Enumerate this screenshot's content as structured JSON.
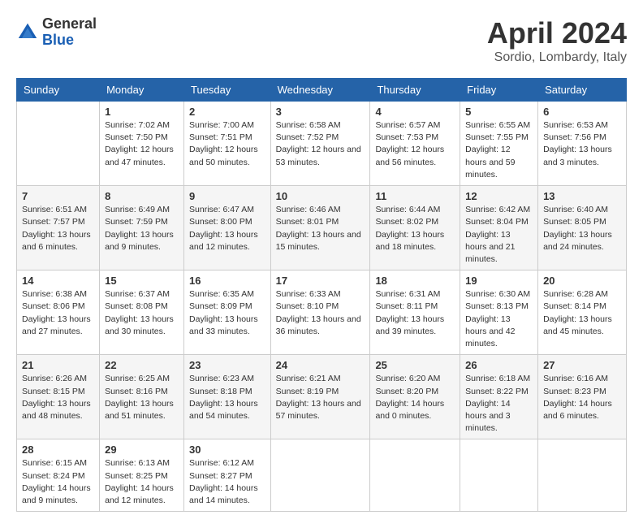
{
  "logo": {
    "general": "General",
    "blue": "Blue"
  },
  "title": "April 2024",
  "subtitle": "Sordio, Lombardy, Italy",
  "days_of_week": [
    "Sunday",
    "Monday",
    "Tuesday",
    "Wednesday",
    "Thursday",
    "Friday",
    "Saturday"
  ],
  "weeks": [
    [
      {
        "day": "",
        "info": ""
      },
      {
        "day": "1",
        "info": "Sunrise: 7:02 AM\nSunset: 7:50 PM\nDaylight: 12 hours\nand 47 minutes."
      },
      {
        "day": "2",
        "info": "Sunrise: 7:00 AM\nSunset: 7:51 PM\nDaylight: 12 hours\nand 50 minutes."
      },
      {
        "day": "3",
        "info": "Sunrise: 6:58 AM\nSunset: 7:52 PM\nDaylight: 12 hours\nand 53 minutes."
      },
      {
        "day": "4",
        "info": "Sunrise: 6:57 AM\nSunset: 7:53 PM\nDaylight: 12 hours\nand 56 minutes."
      },
      {
        "day": "5",
        "info": "Sunrise: 6:55 AM\nSunset: 7:55 PM\nDaylight: 12 hours\nand 59 minutes."
      },
      {
        "day": "6",
        "info": "Sunrise: 6:53 AM\nSunset: 7:56 PM\nDaylight: 13 hours\nand 3 minutes."
      }
    ],
    [
      {
        "day": "7",
        "info": "Sunrise: 6:51 AM\nSunset: 7:57 PM\nDaylight: 13 hours\nand 6 minutes."
      },
      {
        "day": "8",
        "info": "Sunrise: 6:49 AM\nSunset: 7:59 PM\nDaylight: 13 hours\nand 9 minutes."
      },
      {
        "day": "9",
        "info": "Sunrise: 6:47 AM\nSunset: 8:00 PM\nDaylight: 13 hours\nand 12 minutes."
      },
      {
        "day": "10",
        "info": "Sunrise: 6:46 AM\nSunset: 8:01 PM\nDaylight: 13 hours\nand 15 minutes."
      },
      {
        "day": "11",
        "info": "Sunrise: 6:44 AM\nSunset: 8:02 PM\nDaylight: 13 hours\nand 18 minutes."
      },
      {
        "day": "12",
        "info": "Sunrise: 6:42 AM\nSunset: 8:04 PM\nDaylight: 13 hours\nand 21 minutes."
      },
      {
        "day": "13",
        "info": "Sunrise: 6:40 AM\nSunset: 8:05 PM\nDaylight: 13 hours\nand 24 minutes."
      }
    ],
    [
      {
        "day": "14",
        "info": "Sunrise: 6:38 AM\nSunset: 8:06 PM\nDaylight: 13 hours\nand 27 minutes."
      },
      {
        "day": "15",
        "info": "Sunrise: 6:37 AM\nSunset: 8:08 PM\nDaylight: 13 hours\nand 30 minutes."
      },
      {
        "day": "16",
        "info": "Sunrise: 6:35 AM\nSunset: 8:09 PM\nDaylight: 13 hours\nand 33 minutes."
      },
      {
        "day": "17",
        "info": "Sunrise: 6:33 AM\nSunset: 8:10 PM\nDaylight: 13 hours\nand 36 minutes."
      },
      {
        "day": "18",
        "info": "Sunrise: 6:31 AM\nSunset: 8:11 PM\nDaylight: 13 hours\nand 39 minutes."
      },
      {
        "day": "19",
        "info": "Sunrise: 6:30 AM\nSunset: 8:13 PM\nDaylight: 13 hours\nand 42 minutes."
      },
      {
        "day": "20",
        "info": "Sunrise: 6:28 AM\nSunset: 8:14 PM\nDaylight: 13 hours\nand 45 minutes."
      }
    ],
    [
      {
        "day": "21",
        "info": "Sunrise: 6:26 AM\nSunset: 8:15 PM\nDaylight: 13 hours\nand 48 minutes."
      },
      {
        "day": "22",
        "info": "Sunrise: 6:25 AM\nSunset: 8:16 PM\nDaylight: 13 hours\nand 51 minutes."
      },
      {
        "day": "23",
        "info": "Sunrise: 6:23 AM\nSunset: 8:18 PM\nDaylight: 13 hours\nand 54 minutes."
      },
      {
        "day": "24",
        "info": "Sunrise: 6:21 AM\nSunset: 8:19 PM\nDaylight: 13 hours\nand 57 minutes."
      },
      {
        "day": "25",
        "info": "Sunrise: 6:20 AM\nSunset: 8:20 PM\nDaylight: 14 hours\nand 0 minutes."
      },
      {
        "day": "26",
        "info": "Sunrise: 6:18 AM\nSunset: 8:22 PM\nDaylight: 14 hours\nand 3 minutes."
      },
      {
        "day": "27",
        "info": "Sunrise: 6:16 AM\nSunset: 8:23 PM\nDaylight: 14 hours\nand 6 minutes."
      }
    ],
    [
      {
        "day": "28",
        "info": "Sunrise: 6:15 AM\nSunset: 8:24 PM\nDaylight: 14 hours\nand 9 minutes."
      },
      {
        "day": "29",
        "info": "Sunrise: 6:13 AM\nSunset: 8:25 PM\nDaylight: 14 hours\nand 12 minutes."
      },
      {
        "day": "30",
        "info": "Sunrise: 6:12 AM\nSunset: 8:27 PM\nDaylight: 14 hours\nand 14 minutes."
      },
      {
        "day": "",
        "info": ""
      },
      {
        "day": "",
        "info": ""
      },
      {
        "day": "",
        "info": ""
      },
      {
        "day": "",
        "info": ""
      }
    ]
  ]
}
